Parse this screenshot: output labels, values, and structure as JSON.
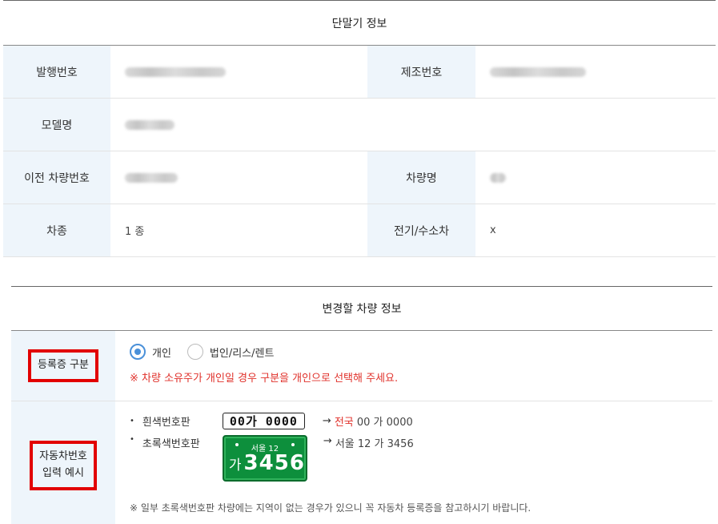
{
  "terminal_section": {
    "title": "단말기 정보",
    "rows": [
      {
        "label1": "발행번호",
        "value1": "",
        "label2": "제조번호",
        "value2": ""
      },
      {
        "label1": "모델명",
        "value1": ""
      },
      {
        "label1": "이전 차량번호",
        "value1": "",
        "label2": "차량명",
        "value2": ""
      },
      {
        "label1": "차종",
        "value1": "1 종",
        "label2": "전기/수소차",
        "value2": "x"
      }
    ]
  },
  "vehicle_section": {
    "title": "변경할 차량 정보",
    "registration": {
      "label": "등록증 구분",
      "options": [
        {
          "label": "개인",
          "selected": true
        },
        {
          "label": "법인/리스/렌트",
          "selected": false
        }
      ],
      "notice": "※ 차량 소유주가 개인일 경우 구분을 개인으로 선택해 주세요."
    },
    "plate_example": {
      "label_line1": "자동차번호",
      "label_line2": "입력 예시",
      "white_plate": {
        "bullet": "•",
        "name": "흰색번호판",
        "plate_text": "00가 0000",
        "arrow": "→",
        "example_region": "전국",
        "example_rest": " 00 가 0000"
      },
      "green_plate": {
        "bullet": "•",
        "name": "초록색번호판",
        "plate_top": "서울 12",
        "plate_ga": "가",
        "plate_num": "3456",
        "arrow": "→",
        "example": "서울 12 가 3456"
      },
      "footnote": "※ 일부 초록색번호판 차량에는 지역이 없는 경우가 있으니 꼭 자동차 등록증을 참고하시기 바랍니다."
    }
  },
  "colors": {
    "label_bg": "#eef5fb",
    "radio_accent": "#4a90d9",
    "notice_red": "#e0312b",
    "highlight_box": "#e20000",
    "green_plate": "#0d8f3c"
  }
}
